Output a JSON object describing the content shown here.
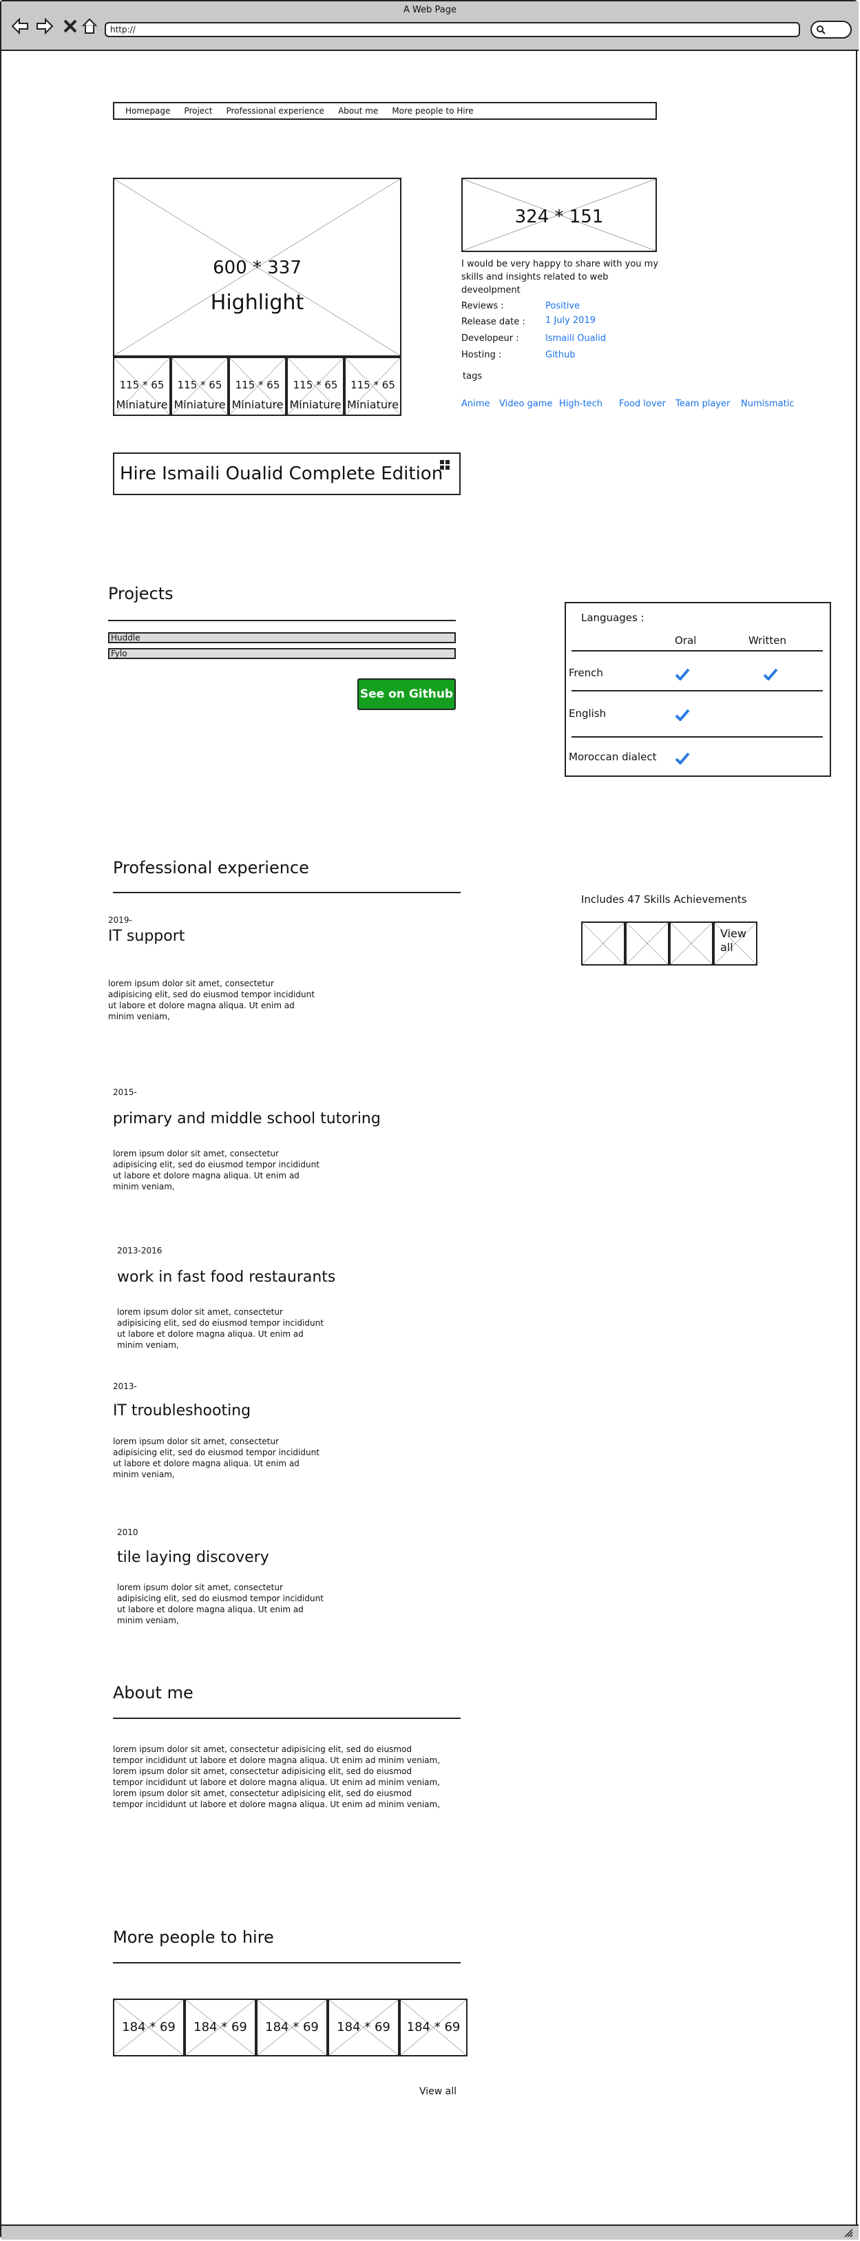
{
  "window": {
    "title": "A Web Page",
    "url": "http://"
  },
  "nav": {
    "items": [
      {
        "label": "Homepage"
      },
      {
        "label": "Project"
      },
      {
        "label": "Professional experience"
      },
      {
        "label": "About me"
      },
      {
        "label": "More people to Hire"
      }
    ]
  },
  "hero": {
    "main_image": {
      "size": "600 * 337",
      "caption": "Highlight"
    },
    "thumbnails": [
      {
        "size": "115 * 65",
        "caption": "Miniature"
      },
      {
        "size": "115 * 65",
        "caption": "Miniature"
      },
      {
        "size": "115 * 65",
        "caption": "Miniature"
      },
      {
        "size": "115 * 65",
        "caption": "Miniature"
      },
      {
        "size": "115 * 65",
        "caption": "Miniature"
      }
    ],
    "side_image": {
      "size": "324 * 151"
    },
    "description": "I would be very happy to share with you my skills and insights related to web deveolpment",
    "details": [
      {
        "label": "Reviews :",
        "value": "Positive"
      },
      {
        "label": "Release date :",
        "value": "1 July 2019"
      },
      {
        "label": "Developeur :",
        "value": "Ismaili Oualid"
      },
      {
        "label": "Hosting :",
        "value": "Github"
      }
    ],
    "tags_label": "tags",
    "tags": [
      "Anime",
      "Video game",
      "High-tech",
      "Food lover",
      "Team player",
      "Numismatic"
    ]
  },
  "hire_button": {
    "label": "Hire Ismaili Oualid Complete Edition",
    "icon": "windows-icon"
  },
  "projects": {
    "title": "Projects",
    "items": [
      "Huddle",
      "Fylo"
    ],
    "github_button": "See on Github"
  },
  "languages": {
    "title": "Languages :",
    "columns": [
      "Oral",
      "Written"
    ],
    "rows": [
      {
        "name": "French",
        "oral": true,
        "written": true
      },
      {
        "name": "English",
        "oral": true,
        "written": false
      },
      {
        "name": "Moroccan dialect",
        "oral": true,
        "written": false
      }
    ],
    "check_color": "#2a7be4"
  },
  "achievements": {
    "title": "Includes 47 Skills Achievements",
    "view_all": "View all"
  },
  "experience": {
    "title": "Professional experience",
    "items": [
      {
        "date": "2019-",
        "title": "IT support",
        "text": "lorem ipsum dolor sit amet, consectetur adipisicing elit, sed do eiusmod tempor incididunt ut labore et dolore magna aliqua. Ut enim ad minim veniam,"
      },
      {
        "date": "2015-",
        "title": "primary and middle school tutoring",
        "text": "lorem ipsum dolor sit amet, consectetur adipisicing elit, sed do eiusmod tempor incididunt ut labore et dolore magna aliqua. Ut enim ad minim veniam,"
      },
      {
        "date": "2013-2016",
        "title": "work in fast food restaurants",
        "text": "lorem ipsum dolor sit amet, consectetur adipisicing elit, sed do eiusmod tempor incididunt ut labore et dolore magna aliqua. Ut enim ad minim veniam,"
      },
      {
        "date": "2013-",
        "title": "IT troubleshooting",
        "text": "lorem ipsum dolor sit amet, consectetur adipisicing elit, sed do eiusmod tempor incididunt ut labore et dolore magna aliqua. Ut enim ad minim veniam,"
      },
      {
        "date": "2010",
        "title": "tile laying discovery",
        "text": "lorem ipsum dolor sit amet, consectetur adipisicing elit, sed do eiusmod tempor incididunt ut labore et dolore magna aliqua. Ut enim ad minim veniam,"
      }
    ]
  },
  "about": {
    "title": "About me",
    "text": "lorem ipsum dolor sit amet, consectetur adipisicing elit, sed do eiusmod tempor incididunt ut labore et dolore magna aliqua. Ut enim ad minim veniam, lorem ipsum dolor sit amet, consectetur adipisicing elit, sed do eiusmod tempor incididunt ut labore et dolore magna aliqua. Ut enim ad minim veniam, lorem ipsum dolor sit amet, consectetur adipisicing elit, sed do eiusmod tempor incididunt ut labore et dolore magna aliqua. Ut enim ad minim veniam,"
  },
  "more_people": {
    "title": "More people to hire",
    "cards": [
      {
        "size": "184 * 69"
      },
      {
        "size": "184 * 69"
      },
      {
        "size": "184 * 69"
      },
      {
        "size": "184 * 69"
      },
      {
        "size": "184 * 69"
      }
    ],
    "view_all": "View all"
  }
}
